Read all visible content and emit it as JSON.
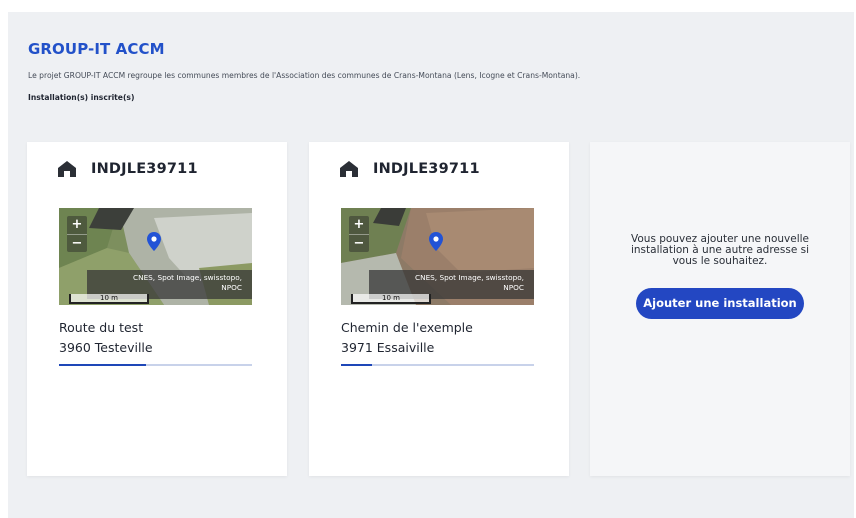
{
  "header": {
    "title": "GROUP-IT ACCM",
    "description": "Le projet GROUP-IT ACCM regroupe les communes membres de l'Association des communes de Crans-Montana (Lens, Icogne et Crans-Montana).",
    "subheading": "Installation(s) inscrite(s)"
  },
  "installations": [
    {
      "id": "INDJLE39711",
      "icon": "home-icon",
      "map": {
        "zoom_in": "+",
        "zoom_out": "−",
        "attribution_line1": "CNES, Spot Image, swisstopo,",
        "attribution_line2": "NPOC",
        "scale": "10 m",
        "marker": "location-pin-icon"
      },
      "address_line1": "Route du test",
      "address_line2": "3960 Testeville",
      "progress": 0.45
    },
    {
      "id": "INDJLE39711",
      "icon": "home-icon",
      "map": {
        "zoom_in": "+",
        "zoom_out": "−",
        "attribution_line1": "CNES, Spot Image, swisstopo,",
        "attribution_line2": "NPOC",
        "scale": "10 m",
        "marker": "location-pin-icon"
      },
      "address_line1": "Chemin de l'exemple",
      "address_line2": "3971 Essaiville",
      "progress": 0.16
    }
  ],
  "add_card": {
    "message": "Vous pouvez ajouter une nouvelle installation à une autre adresse si vous le souhaitez.",
    "button_label": "Ajouter une installation"
  },
  "colors": {
    "accent": "#2251c9",
    "button": "#2347c2",
    "progress_fill": "#1e47b8",
    "progress_track": "#c8d2ea",
    "panel_bg": "#eef0f3"
  }
}
